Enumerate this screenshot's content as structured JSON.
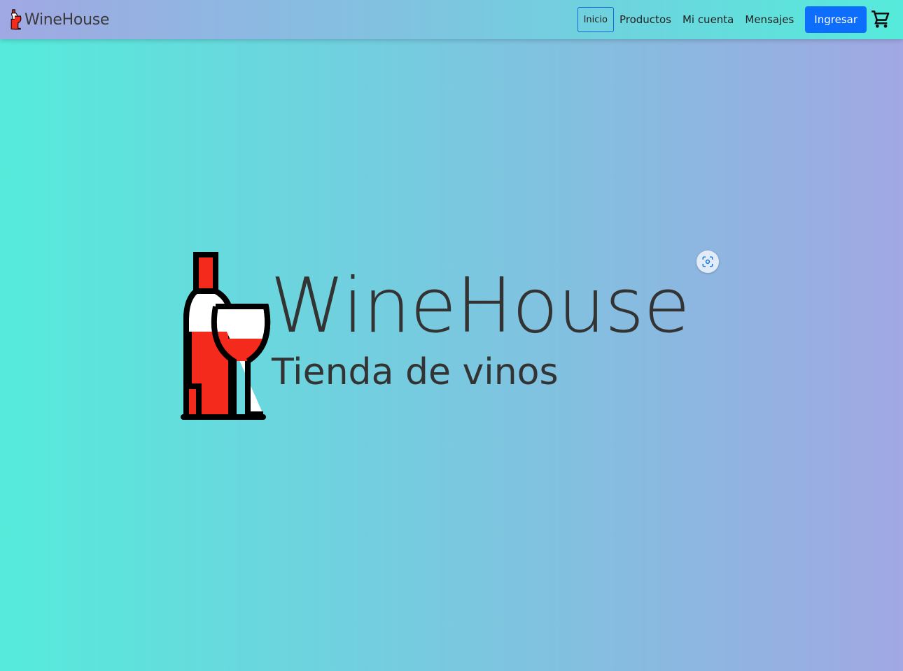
{
  "brand": {
    "name": "WineHouse",
    "logo_icon": "wine-bottle-glass-icon"
  },
  "nav": {
    "items": [
      {
        "label": "Inicio",
        "active": true
      },
      {
        "label": "Productos"
      },
      {
        "label": "Mi cuenta"
      },
      {
        "label": "Mensajes"
      }
    ],
    "login_label": "Ingresar",
    "cart_icon": "cart-icon"
  },
  "hero": {
    "title": "WineHouse",
    "subtitle": "Tienda de vinos",
    "logo_icon": "wine-bottle-glass-icon"
  },
  "overlay": {
    "scan_icon": "visual-search-icon"
  },
  "colors": {
    "wine_red": "#f42b1c",
    "primary_button": "#0d6efd",
    "text": "#333333"
  }
}
